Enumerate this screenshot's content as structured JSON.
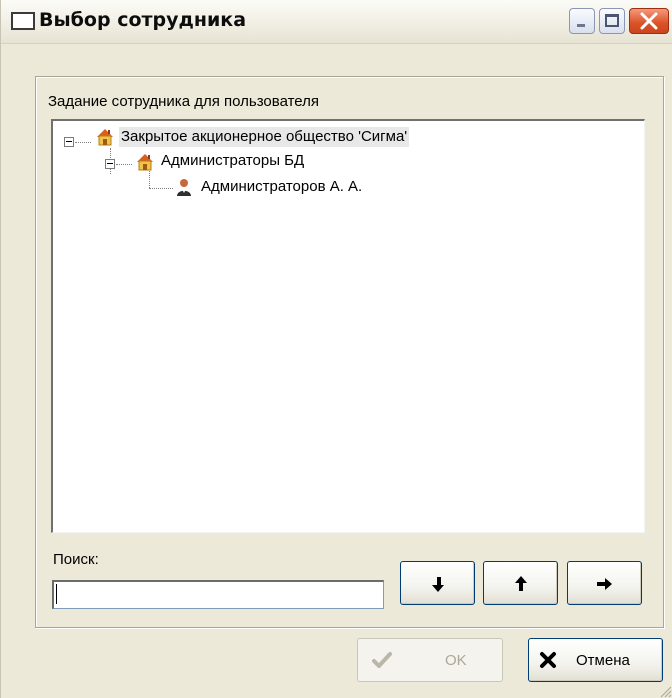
{
  "window": {
    "title": "Выбор сотрудника"
  },
  "group": {
    "label": "Задание сотрудника для пользователя"
  },
  "tree": {
    "nodes": [
      {
        "label": "Закрытое акционерное общество 'Сигма'",
        "icon": "house-icon",
        "expanded": true,
        "selected": true
      },
      {
        "label": "Администраторы БД",
        "icon": "house-icon",
        "expanded": true,
        "selected": false
      },
      {
        "label": "Администраторов А. А.",
        "icon": "person-icon",
        "selected": false
      }
    ]
  },
  "search": {
    "label": "Поиск:",
    "value": ""
  },
  "buttons": {
    "ok_label": "OK",
    "cancel_label": "Отмена"
  },
  "icons": {
    "down": "arrow-down-icon",
    "up": "arrow-up-icon",
    "next": "arrow-right-icon",
    "ok": "checkmark-icon",
    "cancel": "x-icon"
  },
  "colors": {
    "close_button": "#dc5127",
    "ok_disabled_text": "#aca899",
    "cancel_icon": "#000000"
  }
}
